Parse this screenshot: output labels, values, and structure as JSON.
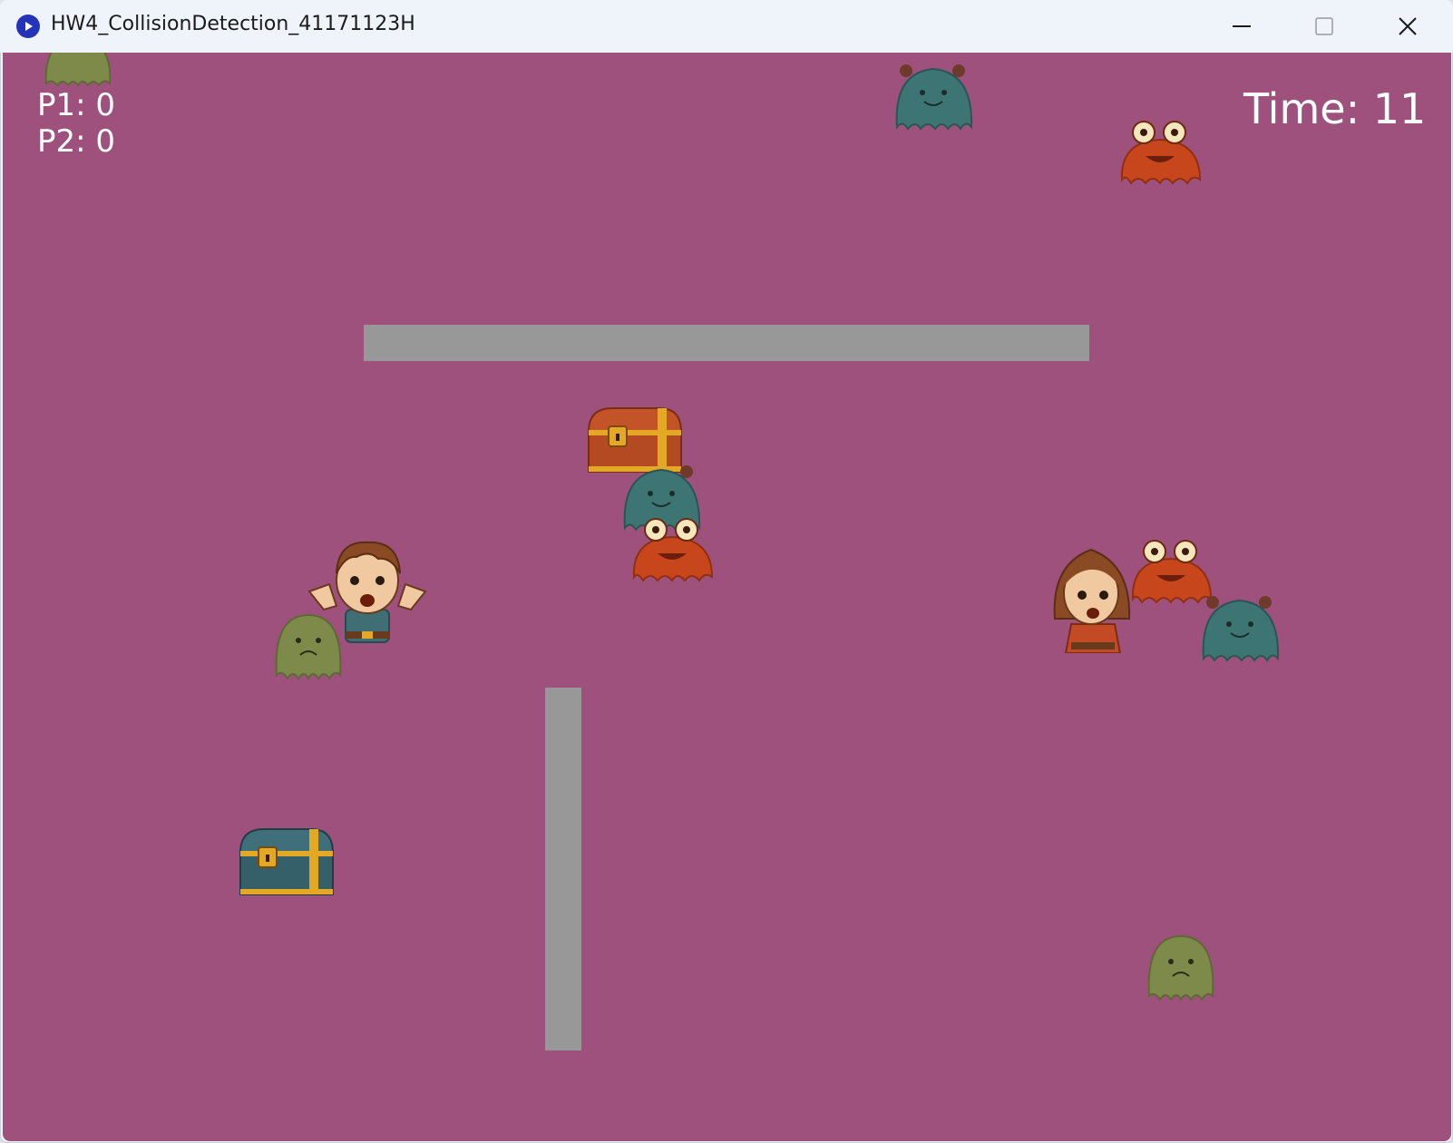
{
  "window": {
    "title": "HW4_CollisionDetection_41171123H",
    "app_icon": "play-circle-icon",
    "controls": [
      "minimize-icon",
      "maximize-icon",
      "close-icon"
    ]
  },
  "game": {
    "background_color": "#9e517c",
    "wall_color": "#989898",
    "hud": {
      "p1_score": "P1: 0",
      "p2_score": "P2: 0",
      "timer": "Time: 11"
    },
    "sprites": {
      "players": [
        "boy-player",
        "girl-player"
      ],
      "chests": [
        "red-treasure-chest",
        "blue-treasure-chest"
      ],
      "enemies": [
        "green-sad-ghost",
        "teal-horned-slime",
        "orange-frog-blob"
      ]
    }
  }
}
